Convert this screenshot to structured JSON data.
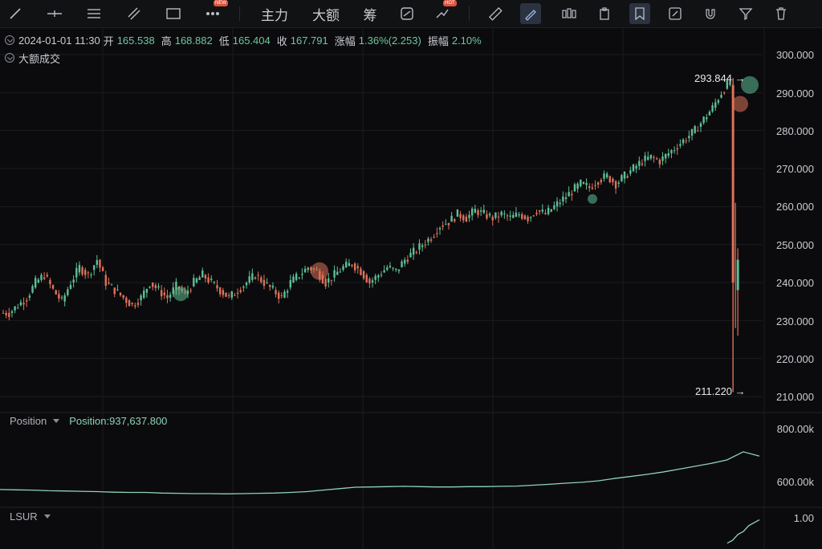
{
  "toolbar": {
    "icons": [
      "line-tool-icon",
      "horizontal-line-icon",
      "parallel-lines-icon",
      "ruler-diagonal-icon",
      "rectangle-icon",
      "more-icon"
    ],
    "more_badge": "NEW",
    "labels": {
      "main_force": "主力",
      "big_volume": "大额",
      "chips": "筹"
    },
    "right_icons": [
      "chip-distribution-icon",
      "compare-icon",
      "measure-icon",
      "brush-icon",
      "candle-style-icon",
      "clipboard-icon",
      "bookmark-icon",
      "edit-icon",
      "magnet-icon",
      "filter-icon",
      "delete-icon"
    ],
    "compare_badge": "HOT"
  },
  "info": {
    "datetime": "2024-01-01 11:30",
    "open_label": "开",
    "open": "165.538",
    "high_label": "高",
    "high": "168.882",
    "low_label": "低",
    "low": "165.404",
    "close_label": "收",
    "close": "167.791",
    "change_label": "涨幅",
    "change": "1.36%(2.253)",
    "amplitude_label": "振幅",
    "amplitude": "2.10%",
    "indicator": "大额成交"
  },
  "price_axis": [
    "300.000",
    "290.000",
    "280.000",
    "270.000",
    "260.000",
    "250.000",
    "240.000",
    "230.000",
    "220.000",
    "210.000"
  ],
  "markers": {
    "max_price": "293.844",
    "min_price": "211.220"
  },
  "position_panel": {
    "label": "Position",
    "value_text": "Position:937,637.800",
    "axis": [
      "800.00k",
      "600.00k"
    ]
  },
  "lsur_panel": {
    "label": "LSUR",
    "axis": [
      "1.00"
    ]
  },
  "colors": {
    "up": "#5fbf96",
    "down": "#e0725a",
    "position_line": "#8fd3b5",
    "grid": "#1a1c20"
  },
  "chart_data": {
    "type": "line",
    "title": "",
    "xlabel": "",
    "ylabel": "",
    "ylim": [
      210,
      300
    ],
    "price_series_approx": [
      232,
      234,
      236,
      240,
      242,
      238,
      235,
      240,
      244,
      242,
      246,
      240,
      238,
      236,
      234,
      236,
      240,
      238,
      236,
      239,
      237,
      240,
      242,
      240,
      238,
      236,
      238,
      240,
      242,
      240,
      238,
      236,
      240,
      242,
      244,
      243,
      240,
      242,
      244,
      245,
      243,
      240,
      242,
      244,
      243,
      246,
      248,
      250,
      252,
      255,
      256,
      258,
      257,
      259,
      258,
      257,
      258,
      257,
      258,
      257,
      259,
      258,
      260,
      262,
      264,
      266,
      265,
      267,
      268,
      266,
      268,
      270,
      272,
      273,
      272,
      274,
      276,
      278,
      280,
      283,
      286,
      290,
      293,
      240,
      246,
      240
    ],
    "position_series_k_approx": [
      610,
      609,
      608,
      606,
      605,
      604,
      603,
      601,
      600,
      600,
      598,
      597,
      596,
      596,
      595,
      596,
      597,
      598,
      600,
      603,
      608,
      613,
      618,
      619,
      620,
      621,
      620,
      619,
      619,
      620,
      620,
      621,
      622,
      625,
      628,
      632,
      635,
      640,
      648,
      655,
      662,
      670,
      680,
      690,
      700,
      712,
      740,
      725
    ],
    "position_ylim_k": [
      560,
      820
    ],
    "lsur_series_approx": [
      0.2,
      0.3,
      0.5,
      0.6,
      0.8,
      0.9,
      1.0
    ],
    "lsur_ylim": [
      0,
      1.1
    ]
  }
}
